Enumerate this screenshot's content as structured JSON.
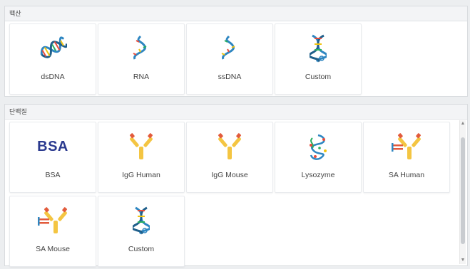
{
  "sections": {
    "nucleic": {
      "title": "핵산",
      "items": [
        {
          "label": "dsDNA",
          "icon": "dsdna-icon"
        },
        {
          "label": "RNA",
          "icon": "rna-icon"
        },
        {
          "label": "ssDNA",
          "icon": "ssdna-icon"
        },
        {
          "label": "Custom",
          "icon": "custom-dna-icon"
        }
      ]
    },
    "protein": {
      "title": "단백질",
      "items": [
        {
          "label": "BSA",
          "icon_text": "BSA"
        },
        {
          "label": "IgG Human",
          "icon": "antibody-icon"
        },
        {
          "label": "IgG Mouse",
          "icon": "antibody-icon"
        },
        {
          "label": "Lysozyme",
          "icon": "lysozyme-icon"
        },
        {
          "label": "SA Human",
          "icon": "sa-antibody-icon"
        },
        {
          "label": "SA Mouse",
          "icon": "sa-antibody-icon"
        },
        {
          "label": "Custom",
          "icon": "custom-dna-icon"
        }
      ]
    }
  },
  "colors": {
    "dna_blue": "#2e86c1",
    "dna_red": "#e74c3c",
    "dna_yellow": "#f1c40f",
    "dna_green": "#27ae60",
    "antibody_yellow": "#f4c542",
    "antibody_red": "#e25b3c",
    "bsa_navy": "#2b3a8f"
  }
}
